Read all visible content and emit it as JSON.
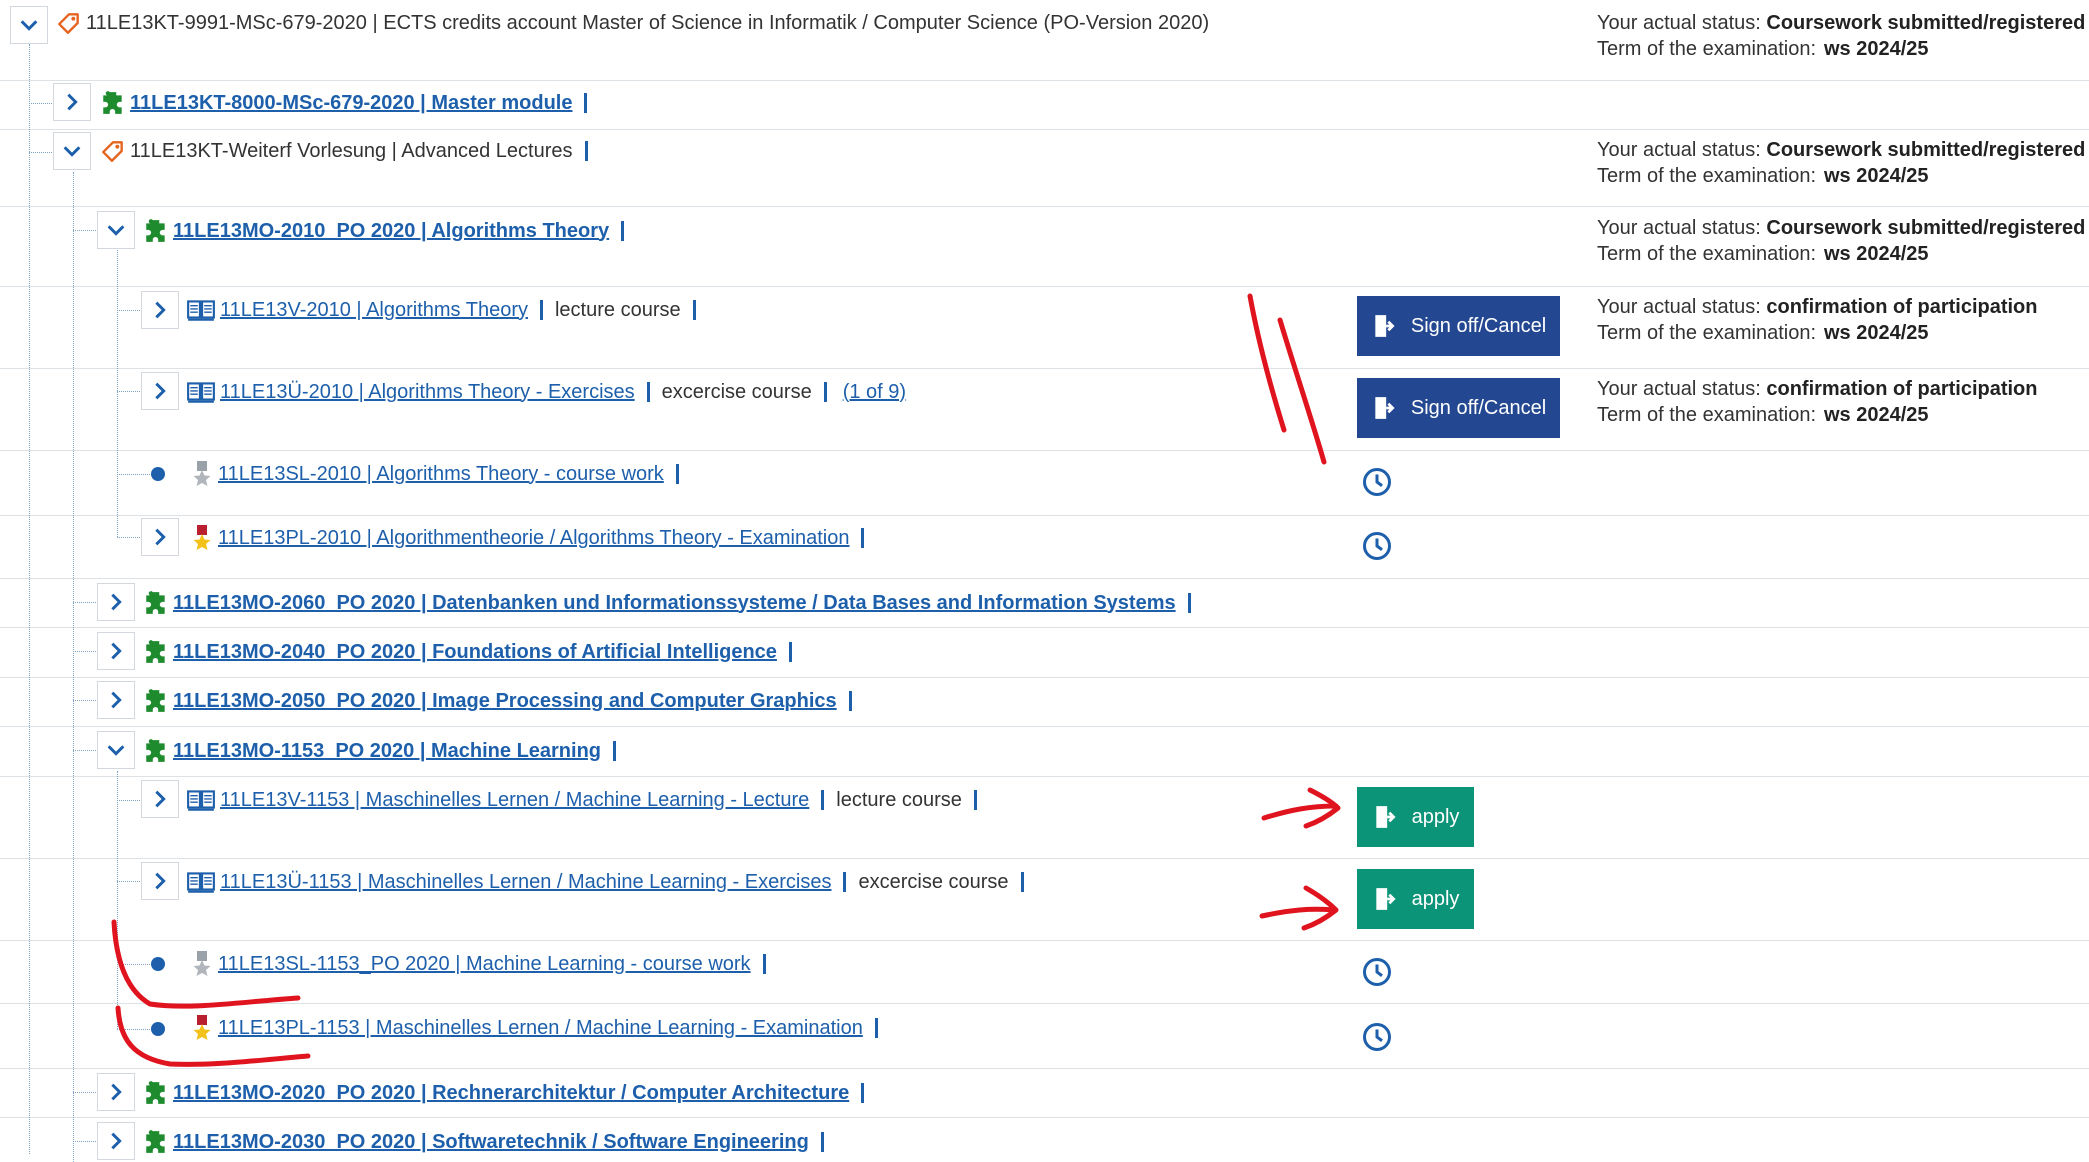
{
  "root": {
    "title": "11LE13KT-9991-MSc-679-2020 | ECTS credits account Master of Science in Informatik / Computer Science (PO-Version 2020)",
    "status_label": "Your actual status:",
    "status_value": "Coursework submitted/registered",
    "term_label": "Term of the examination:",
    "term_value": "ws 2024/25"
  },
  "master_module": {
    "label": "11LE13KT-8000-MSc-679-2020 | Master module"
  },
  "advanced_lectures": {
    "label": "11LE13KT-Weiterf Vorlesung | Advanced Lectures",
    "status_label": "Your actual status:",
    "status_value": "Coursework submitted/registered",
    "term_label": "Term of the examination:",
    "term_value": "ws 2024/25"
  },
  "algorithms_theory": {
    "label": "11LE13MO-2010_PO 2020 | Algorithms Theory",
    "status_label": "Your actual status:",
    "status_value": "Coursework submitted/registered",
    "term_label": "Term of the examination:",
    "term_value": "ws 2024/25",
    "lecture": {
      "label": "11LE13V-2010 | Algorithms Theory",
      "type": "lecture course",
      "button": "Sign off/Cancel",
      "status_label": "Your actual status:",
      "status_value": "confirmation of participation",
      "term_label": "Term of the examination:",
      "term_value": "ws 2024/25"
    },
    "exercises": {
      "label": "11LE13Ü-2010 | Algorithms Theory - Exercises",
      "type": "excercise course",
      "groups": "(1 of 9)",
      "button": "Sign off/Cancel",
      "status_label": "Your actual status:",
      "status_value": "confirmation of participation",
      "term_label": "Term of the examination:",
      "term_value": "ws 2024/25"
    },
    "course_work": {
      "label": "11LE13SL-2010 | Algorithms Theory - course work"
    },
    "examination": {
      "label": "11LE13PL-2010 | Algorithmentheorie / Algorithms Theory - Examination"
    }
  },
  "databases": {
    "label": "11LE13MO-2060_PO 2020 | Datenbanken und Informationssysteme / Data Bases and Information Systems"
  },
  "foundations_ai": {
    "label": "11LE13MO-2040_PO 2020 | Foundations of Artificial Intelligence"
  },
  "image_processing": {
    "label": "11LE13MO-2050_PO 2020 | Image Processing and Computer Graphics"
  },
  "machine_learning": {
    "label": "11LE13MO-1153_PO 2020 | Machine Learning",
    "lecture": {
      "label": "11LE13V-1153 | Maschinelles Lernen / Machine Learning - Lecture",
      "type": "lecture course",
      "button": "apply"
    },
    "exercises": {
      "label": "11LE13Ü-1153 | Maschinelles Lernen / Machine Learning - Exercises",
      "type": "excercise course",
      "button": "apply"
    },
    "course_work": {
      "label": "11LE13SL-1153_PO 2020 | Machine Learning - course work"
    },
    "examination": {
      "label": "11LE13PL-1153 | Maschinelles Lernen / Machine Learning - Examination"
    }
  },
  "computer_architecture": {
    "label": "11LE13MO-2020_PO 2020 | Rechnerarchitektur / Computer Architecture"
  },
  "software_engineering": {
    "label": "11LE13MO-2030_PO 2020 | Softwaretechnik / Software Engineering"
  },
  "colors": {
    "link": "#1d5fab",
    "signoff": "#234891",
    "apply": "#0c9478",
    "module_icon": "#1e8c2e",
    "annotation": "#e0141e"
  },
  "icons": [
    "chevron-down-icon",
    "chevron-right-icon",
    "tag-icon",
    "puzzle-icon",
    "book-icon",
    "medal-silver-icon",
    "medal-gold-icon",
    "clock-icon",
    "sign-off-icon"
  ]
}
